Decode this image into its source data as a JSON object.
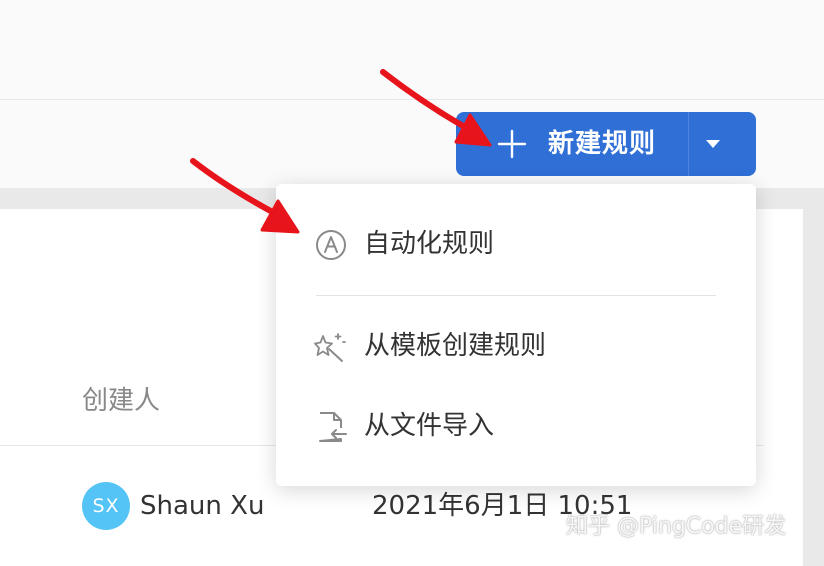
{
  "toolbar": {
    "new_rule_label": "新建规则",
    "plus_icon": "plus-icon",
    "caret_icon": "caret-down-icon"
  },
  "dropdown": {
    "items": [
      {
        "label": "自动化规则",
        "icon": "automation-a-circle-icon"
      },
      {
        "label": "从模板创建规则",
        "icon": "magic-wand-sparkle-icon"
      },
      {
        "label": "从文件导入",
        "icon": "file-import-icon"
      }
    ]
  },
  "table": {
    "columns": [
      "创建人"
    ],
    "rows": [
      {
        "avatar_initials": "SX",
        "creator": "Shaun Xu",
        "created_at": "2021年6月1日 10:51"
      }
    ]
  },
  "watermark": {
    "text": "知乎 @PingCode研发"
  },
  "colors": {
    "primary": "#2f6fd6",
    "avatar": "#54c3f5",
    "annotation_arrow": "#e8141b"
  }
}
